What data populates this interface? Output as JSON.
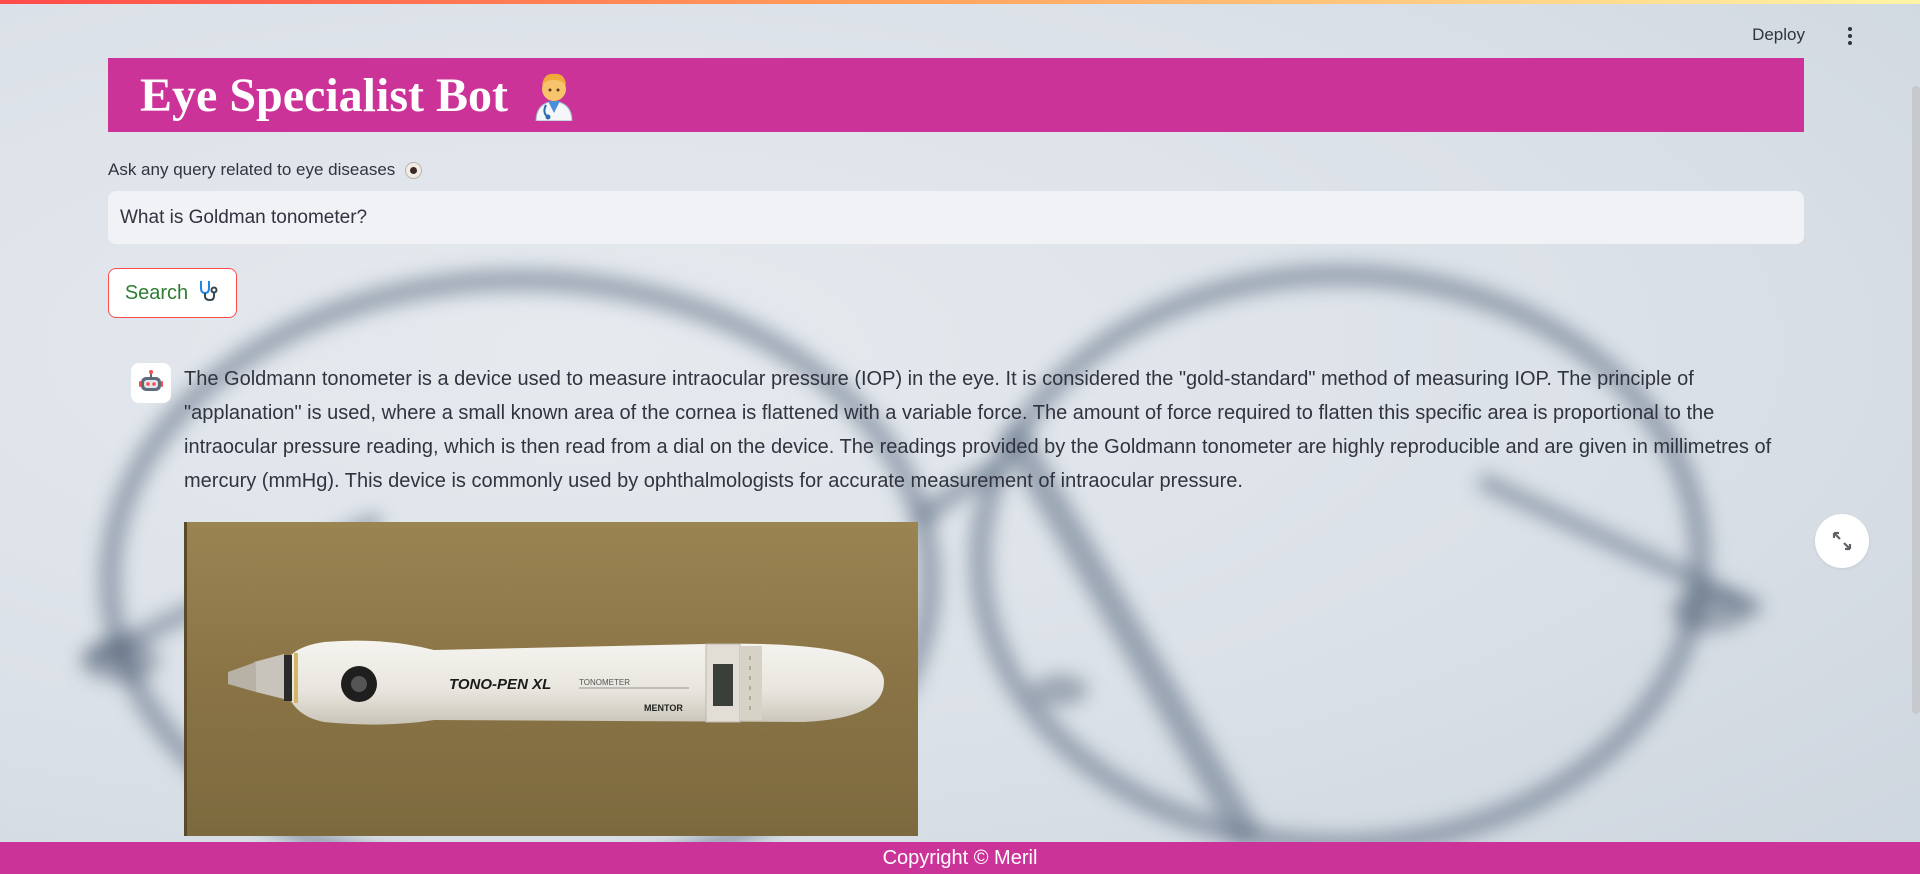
{
  "header": {
    "deploy_label": "Deploy",
    "menu_icon": "kebab-menu-icon"
  },
  "banner": {
    "title": "Eye Specialist Bot",
    "emoji": "doctor-emoji",
    "color": "#cc3399"
  },
  "query": {
    "label": "Ask any query related to eye diseases",
    "label_icon": "eye-icon",
    "value": "What is Goldman tonometer?"
  },
  "search": {
    "label": "Search",
    "icon": "stethoscope-icon",
    "border_color": "#ff4b4b",
    "text_color": "#2e7d32"
  },
  "response": {
    "avatar": "bot-avatar-icon",
    "text": "The Goldmann tonometer is a device used to measure intraocular pressure (IOP) in the eye. It is considered the \"gold-standard\" method of measuring IOP. The principle of \"applanation\" is used, where a small known area of the cornea is flattened with a variable force. The amount of force required to flatten this specific area is proportional to the intraocular pressure reading, which is then read from a dial on the device. The readings provided by the Goldmann tonometer are highly reproducible and are given in millimetres of mercury (mmHg). This device is commonly used by ophthalmologists for accurate measurement of intraocular pressure.",
    "image": {
      "brand_text": "TONO-PEN XL",
      "label_text": "TONOMETER",
      "maker_text": "MENTOR"
    }
  },
  "expand_icon": "fullscreen-expand-icon",
  "footer": {
    "text": "Copyright © Meril"
  }
}
